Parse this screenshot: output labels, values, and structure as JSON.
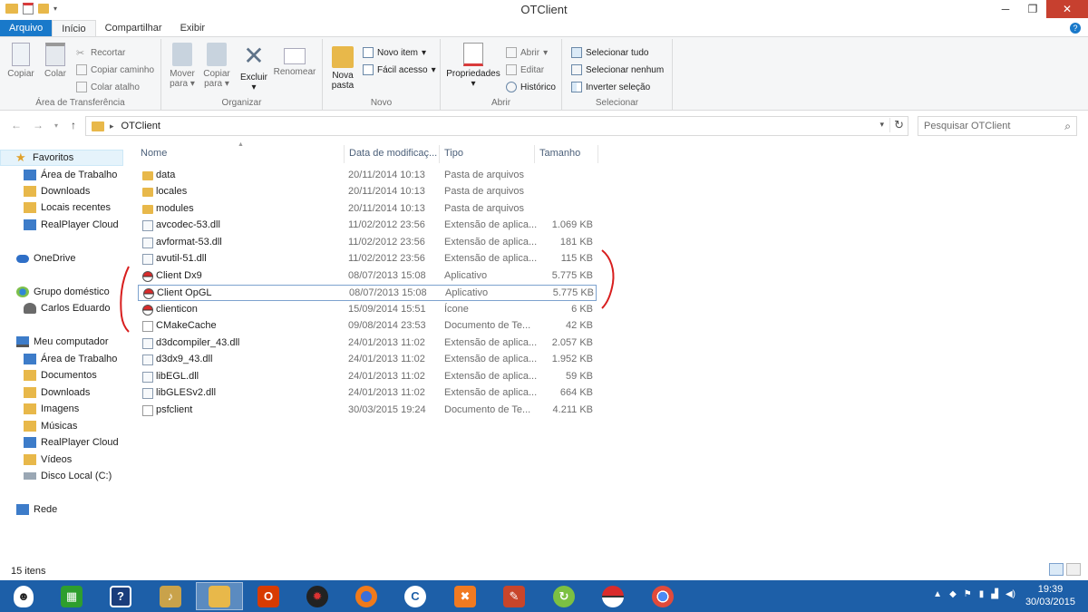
{
  "window": {
    "title": "OTClient"
  },
  "tabs": [
    {
      "label": "Arquivo"
    },
    {
      "label": "Início"
    },
    {
      "label": "Compartilhar"
    },
    {
      "label": "Exibir"
    }
  ],
  "ribbon": {
    "clipboard": {
      "label": "Área de Transferência",
      "copy": "Copiar",
      "paste": "Colar",
      "cut": "Recortar",
      "copy_path": "Copiar caminho",
      "paste_shortcut": "Colar atalho"
    },
    "organize": {
      "label": "Organizar",
      "move_to": "Mover",
      "move_to2": "para",
      "copy_to": "Copiar",
      "copy_to2": "para",
      "delete": "Excluir",
      "rename": "Renomear"
    },
    "new": {
      "label": "Novo",
      "new_folder": "Nova",
      "new_folder2": "pasta",
      "new_item": "Novo item",
      "easy_access": "Fácil acesso"
    },
    "open": {
      "label": "Abrir",
      "properties": "Propriedades",
      "open": "Abrir",
      "edit": "Editar",
      "history": "Histórico"
    },
    "select": {
      "label": "Selecionar",
      "select_all": "Selecionar tudo",
      "select_none": "Selecionar nenhum",
      "invert": "Inverter seleção"
    }
  },
  "address": {
    "path": "OTClient",
    "search_placeholder": "Pesquisar OTClient"
  },
  "nav": {
    "favorites": "Favoritos",
    "desktop": "Área de Trabalho",
    "downloads": "Downloads",
    "recent": "Locais recentes",
    "realplayer": "RealPlayer Cloud",
    "onedrive": "OneDrive",
    "homegroup": "Grupo doméstico",
    "user": "Carlos Eduardo",
    "computer": "Meu computador",
    "pc_desktop": "Área de Trabalho",
    "pc_documents": "Documentos",
    "pc_downloads": "Downloads",
    "pc_images": "Imagens",
    "pc_music": "Músicas",
    "pc_realplayer": "RealPlayer Cloud",
    "pc_videos": "Vídeos",
    "pc_disk": "Disco Local (C:)",
    "network": "Rede"
  },
  "columns": {
    "name": "Nome",
    "date": "Data de modificaç...",
    "type": "Tipo",
    "size": "Tamanho"
  },
  "files": [
    {
      "name": "data",
      "date": "20/11/2014 10:13",
      "type": "Pasta de arquivos",
      "size": ""
    },
    {
      "name": "locales",
      "date": "20/11/2014 10:13",
      "type": "Pasta de arquivos",
      "size": ""
    },
    {
      "name": "modules",
      "date": "20/11/2014 10:13",
      "type": "Pasta de arquivos",
      "size": ""
    },
    {
      "name": "avcodec-53.dll",
      "date": "11/02/2012 23:56",
      "type": "Extensão de aplica...",
      "size": "1.069 KB"
    },
    {
      "name": "avformat-53.dll",
      "date": "11/02/2012 23:56",
      "type": "Extensão de aplica...",
      "size": "181 KB"
    },
    {
      "name": "avutil-51.dll",
      "date": "11/02/2012 23:56",
      "type": "Extensão de aplica...",
      "size": "115 KB"
    },
    {
      "name": "Client Dx9",
      "date": "08/07/2013 15:08",
      "type": "Aplicativo",
      "size": "5.775 KB"
    },
    {
      "name": "Client OpGL",
      "date": "08/07/2013 15:08",
      "type": "Aplicativo",
      "size": "5.775 KB"
    },
    {
      "name": "clienticon",
      "date": "15/09/2014 15:51",
      "type": "Ícone",
      "size": "6 KB"
    },
    {
      "name": "CMakeCache",
      "date": "09/08/2014 23:53",
      "type": "Documento de Te...",
      "size": "42 KB"
    },
    {
      "name": "d3dcompiler_43.dll",
      "date": "24/01/2013 11:02",
      "type": "Extensão de aplica...",
      "size": "2.057 KB"
    },
    {
      "name": "d3dx9_43.dll",
      "date": "24/01/2013 11:02",
      "type": "Extensão de aplica...",
      "size": "1.952 KB"
    },
    {
      "name": "libEGL.dll",
      "date": "24/01/2013 11:02",
      "type": "Extensão de aplica...",
      "size": "59 KB"
    },
    {
      "name": "libGLESv2.dll",
      "date": "24/01/2013 11:02",
      "type": "Extensão de aplica...",
      "size": "664 KB"
    },
    {
      "name": "psfclient",
      "date": "30/03/2015 19:24",
      "type": "Documento de Te...",
      "size": "4.211 KB"
    }
  ],
  "status": {
    "count": "15 itens"
  },
  "clock": {
    "time": "19:39",
    "date": "30/03/2015"
  }
}
